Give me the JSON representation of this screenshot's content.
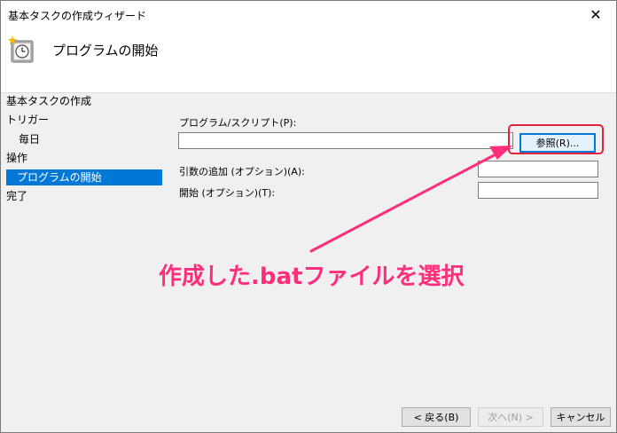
{
  "window": {
    "title": "基本タスクの作成ウィザード",
    "close_glyph": "✕"
  },
  "header": {
    "title": "プログラムの開始",
    "icon": "task-scheduler-clock-icon"
  },
  "sidebar": {
    "items": [
      {
        "label": "基本タスクの作成"
      },
      {
        "label": "トリガー"
      },
      {
        "label": "毎日"
      },
      {
        "label": "操作"
      },
      {
        "label": "プログラムの開始"
      },
      {
        "label": "完了"
      }
    ],
    "selected_index": 4
  },
  "form": {
    "program_label": "プログラム/スクリプト(P):",
    "program_value": "",
    "browse_label": "参照(R)...",
    "args_label": "引数の追加 (オプション)(A):",
    "args_value": "",
    "start_label": "開始 (オプション)(T):",
    "start_value": ""
  },
  "footer": {
    "back_label": "< 戻る(B)",
    "next_label": "次へ(N) >",
    "cancel_label": "キャンセル"
  },
  "annotation": {
    "text": "作成した.batファイルを選択",
    "color": "#ff2e7a",
    "highlight_color": "#e02440"
  },
  "colors": {
    "selection": "#0078d7"
  }
}
